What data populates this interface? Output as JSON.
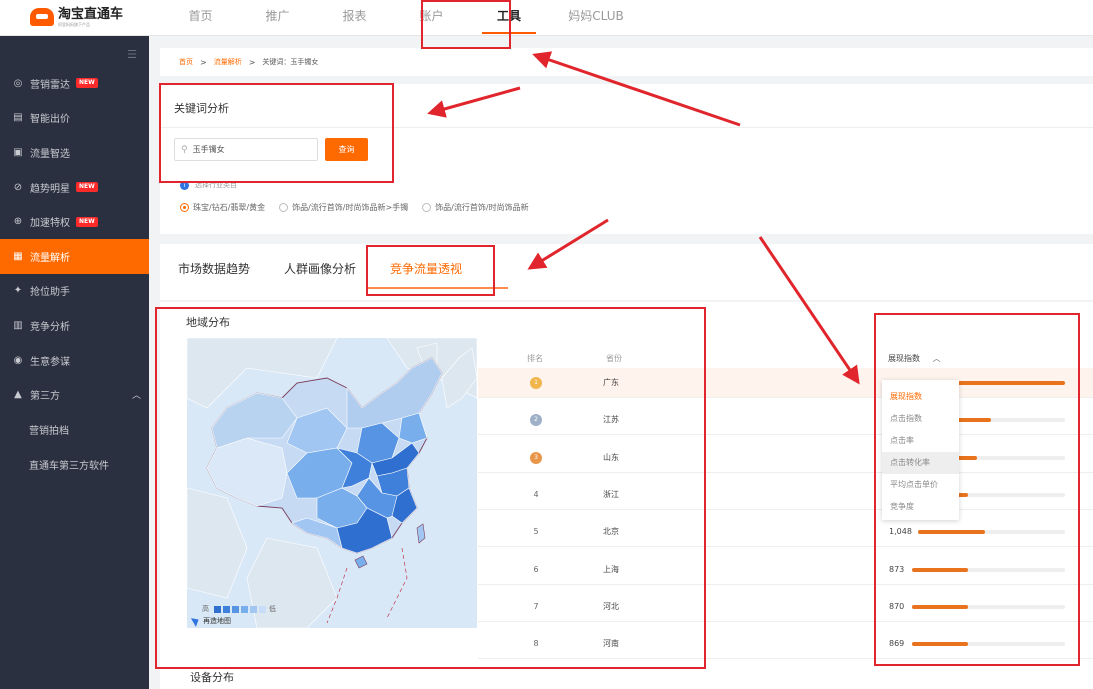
{
  "app": {
    "title": "淘宝直通车",
    "subtitle": "阿里妈妈旗下产品"
  },
  "topnav": {
    "items": [
      "首页",
      "推广",
      "报表",
      "账户",
      "工具",
      "妈妈CLUB"
    ],
    "active": "工具"
  },
  "sidebar": {
    "collapse_icon": "menu-collapse-icon",
    "items": [
      {
        "label": "营销雷达",
        "badge": "NEW",
        "icon": "radar-icon"
      },
      {
        "label": "智能出价",
        "icon": "bid-icon"
      },
      {
        "label": "流量智选",
        "icon": "traffic-icon"
      },
      {
        "label": "趋势明星",
        "badge": "NEW",
        "icon": "trend-icon"
      },
      {
        "label": "加速特权",
        "badge": "NEW",
        "icon": "speed-icon"
      },
      {
        "label": "流量解析",
        "icon": "analysis-icon",
        "active": true
      },
      {
        "label": "抢位助手",
        "icon": "rank-icon"
      },
      {
        "label": "竞争分析",
        "icon": "compete-icon"
      },
      {
        "label": "生意参谋",
        "icon": "business-icon"
      },
      {
        "label": "第三方",
        "icon": "third-party-icon",
        "expanded": true
      }
    ],
    "sub_items": [
      "营销拍档",
      "直通车第三方软件"
    ]
  },
  "breadcrumb": {
    "home": "首页",
    "section": "流量解析",
    "current": "关键词：玉手镯女"
  },
  "keyword_panel": {
    "title": "关键词分析",
    "search_value": "玉手镯女",
    "search_button": "查询",
    "category_tip": "选择行业类目",
    "categories": [
      "珠宝/钻石/翡翠/黄金",
      "饰品/流行首饰/时尚饰品新>手镯",
      "饰品/流行首饰/时尚饰品新"
    ],
    "selected_category": 0
  },
  "tabs": {
    "items": [
      "市场数据趋势",
      "人群画像分析",
      "竞争流量透视"
    ],
    "active": 2
  },
  "region": {
    "title": "地域分布",
    "legend_high": "高",
    "legend_low": "低",
    "legend_colors": [
      "#2f6fcf",
      "#3f80db",
      "#5795e4",
      "#79aeec",
      "#a2c6f2",
      "#c8ddf7"
    ],
    "map_note": "再造地图",
    "col_rank": "排名",
    "col_province": "省份",
    "metric_label": "展现指数",
    "rows": [
      {
        "rank": "1",
        "province": "广东",
        "value": "",
        "pct": 100
      },
      {
        "rank": "2",
        "province": "江苏",
        "value": "",
        "pct": 58
      },
      {
        "rank": "3",
        "province": "山东",
        "value": "",
        "pct": 50
      },
      {
        "rank": "4",
        "province": "浙江",
        "value": "",
        "pct": 45
      },
      {
        "rank": "5",
        "province": "北京",
        "value": "1,048",
        "pct": 38
      },
      {
        "rank": "6",
        "province": "上海",
        "value": "873",
        "pct": 32
      },
      {
        "rank": "7",
        "province": "河北",
        "value": "870",
        "pct": 32
      },
      {
        "rank": "8",
        "province": "河南",
        "value": "869",
        "pct": 32
      }
    ],
    "metric_options": [
      "展现指数",
      "点击指数",
      "点击率",
      "点击转化率",
      "平均点击单价",
      "竞争度"
    ],
    "selected_metric": 0,
    "hover_metric": 3
  },
  "device": {
    "title": "设备分布"
  },
  "colors": {
    "accent": "#ff6a00",
    "annotation": "#e0262c",
    "sidebar": "#2b3040"
  }
}
